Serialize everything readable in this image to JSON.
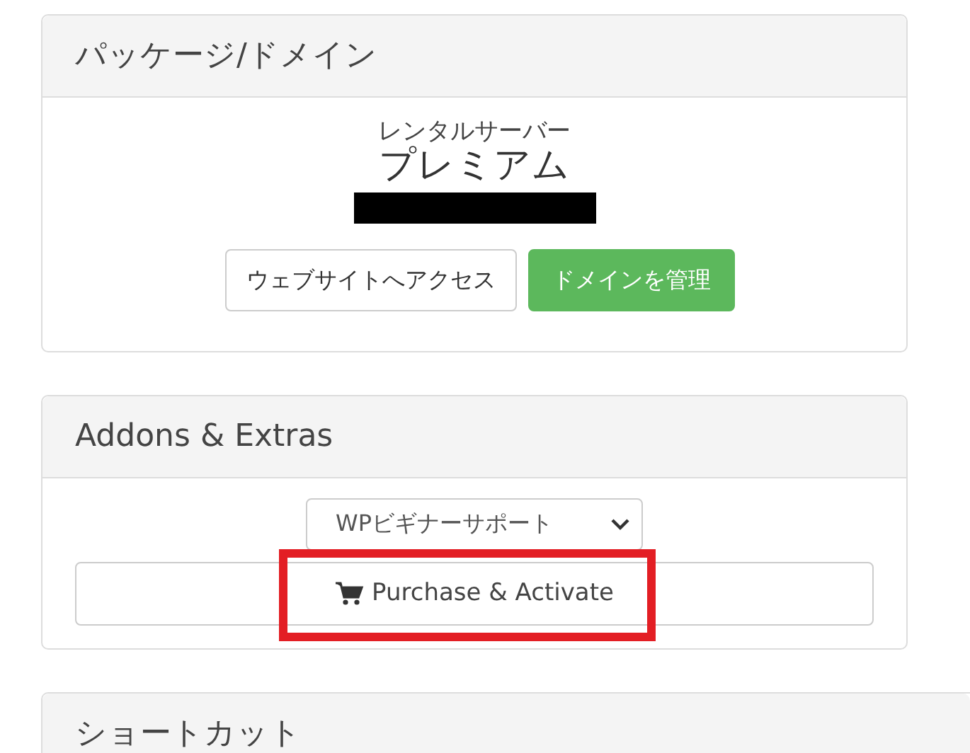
{
  "panels": [
    {
      "kind": "package",
      "title": "パッケージ/ドメイン",
      "product_group": "レンタルサーバー",
      "product_name": "プレミアム",
      "redacted": true,
      "buttons": [
        {
          "label": "ウェブサイトへアクセス",
          "kind": "plain"
        },
        {
          "label": "ドメインを管理",
          "kind": "success"
        }
      ]
    },
    {
      "kind": "addons",
      "title": "Addons & Extras",
      "select_value": "WPビギナーサポート",
      "button": {
        "label": "Purchase & Activate",
        "highlighted": true
      }
    },
    {
      "kind": "header_only",
      "title": "ショートカット"
    }
  ]
}
